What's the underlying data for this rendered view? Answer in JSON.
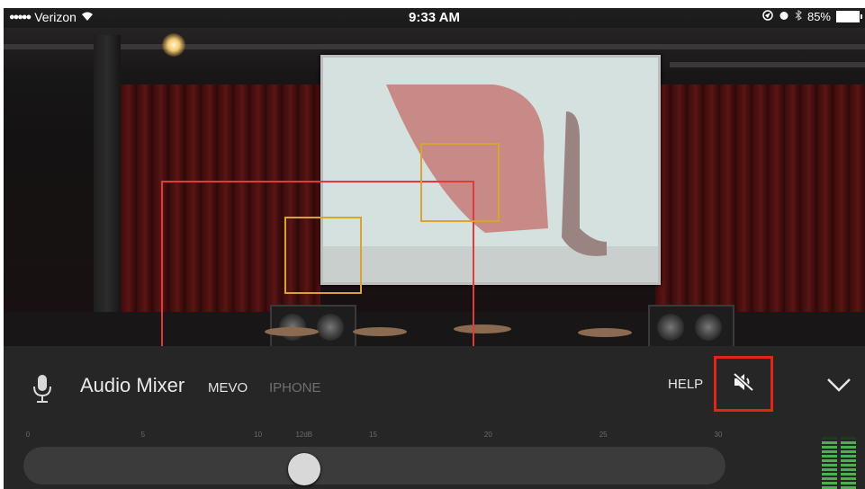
{
  "status_bar": {
    "signal_dots": "●●●●●",
    "carrier": "Verizon",
    "wifi_icon": "wifi-icon",
    "time": "9:33 AM",
    "battery_percent": "85%",
    "battery_level": 0.85
  },
  "mixer": {
    "title": "Audio Mixer",
    "tabs": [
      {
        "label": "MEVO",
        "active": true
      },
      {
        "label": "IPHONE",
        "active": false
      }
    ],
    "help_label": "HELP",
    "mute_icon": "speaker-muted-icon",
    "collapse_icon": "chevron-down-icon",
    "mic_icon": "microphone-icon",
    "scale_ticks": [
      "0",
      "5",
      "10",
      "12dB",
      "15",
      "20",
      "25",
      "30"
    ],
    "scale_values": [
      0,
      5,
      10,
      12,
      15,
      20,
      25,
      30
    ],
    "slider_value_db": 12,
    "meter_levels": [
      0.95,
      0.95
    ]
  },
  "colors": {
    "highlight_red": "#e12618",
    "selection_red": "#e03a3a",
    "selection_yellow": "#d7a431",
    "panel_bg": "#262626",
    "meter_green": "#4caf50"
  }
}
